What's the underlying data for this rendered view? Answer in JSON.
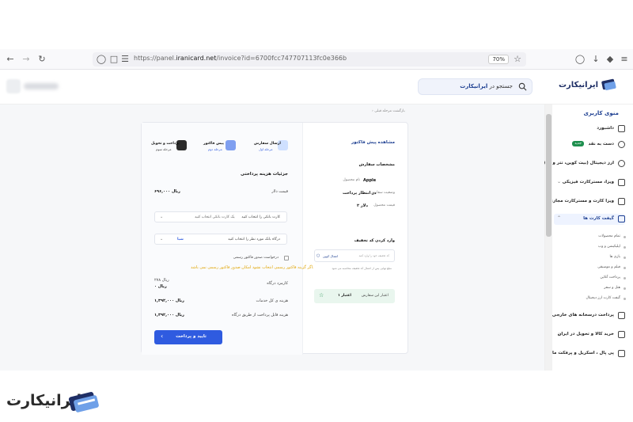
{
  "browser": {
    "url_prefix": "https://panel.",
    "url_host": "iranicard.net",
    "url_path": "/invoice?id=6700fcc747707113fc0e366b",
    "zoom": "70%"
  },
  "header": {
    "logo_text": "ایرانیکارت",
    "search_text": "جستجو در",
    "search_brand": "ایرانیکارت"
  },
  "sidebar": {
    "title": "منوی کاربری",
    "items": [
      {
        "label": "داشبورد"
      },
      {
        "label": "دست به نقد",
        "badge": "جدید"
      },
      {
        "label": "ارز دیجیتال (بیت کوین، تتر و ...)"
      },
      {
        "label": "ویزا، مسترکارت فیزیکی"
      },
      {
        "label": "ویزا کارت و مسترکارت مجازی"
      },
      {
        "label": "گیفت کارت ها"
      },
      {
        "label": "پرداخت درسخانه های خارجی"
      },
      {
        "label": "خرید کالا و تحویل در ایران"
      },
      {
        "label": "پی پال ، اسکریل و پرفکت مانی"
      }
    ],
    "subitems": [
      "تمام محصولات",
      "اپلیکیشن و وب",
      "بازی ها",
      "فیلم و موسیقی",
      "پرداخت آنلاین",
      "هتل و سفر",
      "گیفت کارت ارز دیجیتال"
    ]
  },
  "breadcrumb": "بازگشت مرحله قبلی",
  "invoice": {
    "steps": [
      {
        "title": "ارسال سفارش",
        "sub": "مرحله اول"
      },
      {
        "title": "پیش فاکتور",
        "sub": "مرحله دوم"
      },
      {
        "title": "پرداخت و تحویل",
        "sub": "مرحله سوم"
      }
    ],
    "section_title": "جزئیات هزینه پرداختی",
    "rate_label": "قیمت دلار",
    "rate_value": "۶۹۶,۰۰۰ ریال",
    "bank_select": "کارت بانکی را انتخاب کنید",
    "bank_select_hint": "یک کارت بانکی انتخاب کنید",
    "gateway_select": "درگاه بانک مورد نظر را انتخاب کنید",
    "gateway_value": "شبا",
    "official_invoice": "درخواست صدور فاکتور رسمی",
    "warning": "اگر گزینه فاکتور رسمی انتخاب نشود امکان صدور فاکتور رسمی نمی باشد.",
    "fee_label": "کارمزد درگاه",
    "fee_value": "۲۷۸ ریال",
    "fee_value2": "۰ ریال",
    "service_label": "هزینه ی کل خدمات",
    "service_value": "۱,۳۹۲,۰۰۰ ریال",
    "total_label": "هزینه قابل پرداخت از طریق درگاه",
    "total_value": "۱,۳۹۲,۰۰۰ ریال",
    "pay_button": "تایید و پرداخت",
    "view_title": "مشاهده پیش فاکتور",
    "order_title": "مشخصات سفارش",
    "product_label": "نام محصول",
    "product_value": "Apple",
    "status_label": "وضعیت سفارش",
    "status_value": "در انتظار پرداخت",
    "price_label": "قیمت محصول",
    "price_value": "۲ دلار",
    "discount_title": "وارد کردن کد تخفیف",
    "discount_placeholder": "کد تخفیف خود را وارد کنید",
    "discount_button": "اعمال کوپن",
    "discount_note": "مبلغ نهایی پس از اعمال کد تخفیف محاسبه می شود",
    "credit_label": "اعتبار این سفارش",
    "credit_value": "۱ اعتبار"
  },
  "bottom_logo": "ایرانیکارت",
  "colors": {
    "brand": "#1d3f91",
    "primary_button": "#2f5be0",
    "warning": "#e0a400",
    "badge": "#1e8f4e"
  }
}
